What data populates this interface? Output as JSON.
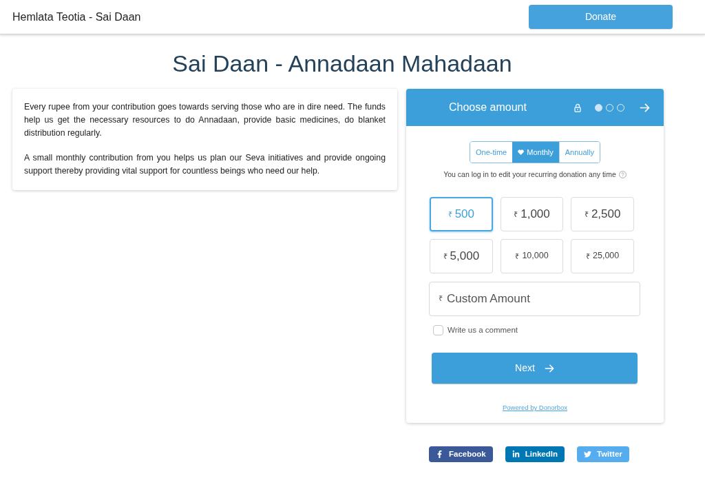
{
  "header": {
    "title": "Hemlata Teotia - Sai Daan",
    "donate_button": "Donate"
  },
  "page_title": "Sai Daan - Annadaan Mahadaan",
  "description": {
    "paragraphs": [
      "Every rupee from your contribution goes towards serving those who are in dire need. The funds help us get the necessary resources to do Annadaan, provide basic medicines,  do blanket distribution regularly.",
      "A small monthly contribution from you helps us plan our Seva initiatives and provide ongoing support thereby providing vital support for countless beings who need our help."
    ]
  },
  "donation_form": {
    "header": {
      "title": "Choose amount",
      "steps": [
        {
          "selected": true
        },
        {
          "selected": false
        },
        {
          "selected": false
        }
      ]
    },
    "frequencies": [
      {
        "label": "One-time",
        "selected": false
      },
      {
        "label": "Monthly",
        "selected": true
      },
      {
        "label": "Annually",
        "selected": false
      }
    ],
    "recurring_note": "You can log in to edit your recurring donation any time",
    "amounts": [
      {
        "currency": "₹",
        "value": "500",
        "selected": true
      },
      {
        "currency": "₹",
        "value": "1,000",
        "selected": false
      },
      {
        "currency": "₹",
        "value": "2,500",
        "selected": false
      },
      {
        "currency": "₹",
        "value": "5,000",
        "selected": false
      },
      {
        "currency": "₹",
        "value": "10,000",
        "selected": false
      },
      {
        "currency": "₹",
        "value": "25,000",
        "selected": false
      }
    ],
    "custom_amount": {
      "currency": "₹",
      "placeholder": "Custom Amount"
    },
    "comment": {
      "label": "Write us a comment",
      "checked": false
    },
    "next_button": "Next",
    "powered_by": "Powered by Donorbox"
  },
  "share_buttons": [
    {
      "kind": "facebook",
      "label": "Facebook"
    },
    {
      "kind": "linkedin",
      "label": "LinkedIn"
    },
    {
      "kind": "twitter",
      "label": "Twitter"
    }
  ]
}
